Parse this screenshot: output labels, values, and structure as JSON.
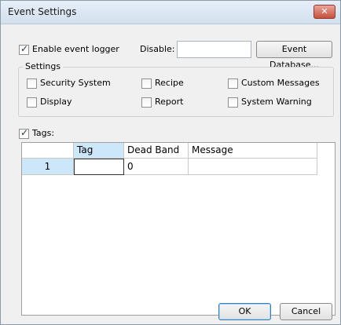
{
  "window": {
    "title": "Event Settings",
    "close_glyph": "✕"
  },
  "logger": {
    "enable_label": "Enable event logger",
    "enable_checked": true,
    "disable_label": "Disable:",
    "disable_value": "",
    "event_database_button": "Event Database..."
  },
  "settings": {
    "group_label": "Settings",
    "items": [
      {
        "label": "Security System",
        "checked": false
      },
      {
        "label": "Recipe",
        "checked": false
      },
      {
        "label": "Custom Messages",
        "checked": false
      },
      {
        "label": "Display",
        "checked": false
      },
      {
        "label": "Report",
        "checked": false
      },
      {
        "label": "System Warning",
        "checked": false
      }
    ]
  },
  "tags": {
    "label": "Tags:",
    "checked": true,
    "columns": [
      "",
      "Tag Name",
      "Dead Band",
      "Message"
    ],
    "rows": [
      {
        "row": "1",
        "tag_name": "",
        "dead_band": "0",
        "message": ""
      }
    ]
  },
  "footer": {
    "ok_label": "OK",
    "cancel_label": "Cancel"
  },
  "colors": {
    "selected_header": "#cce6fa",
    "close_button": "#c6503d"
  },
  "icons": {
    "close": "close-icon",
    "check": "checkmark-icon"
  }
}
